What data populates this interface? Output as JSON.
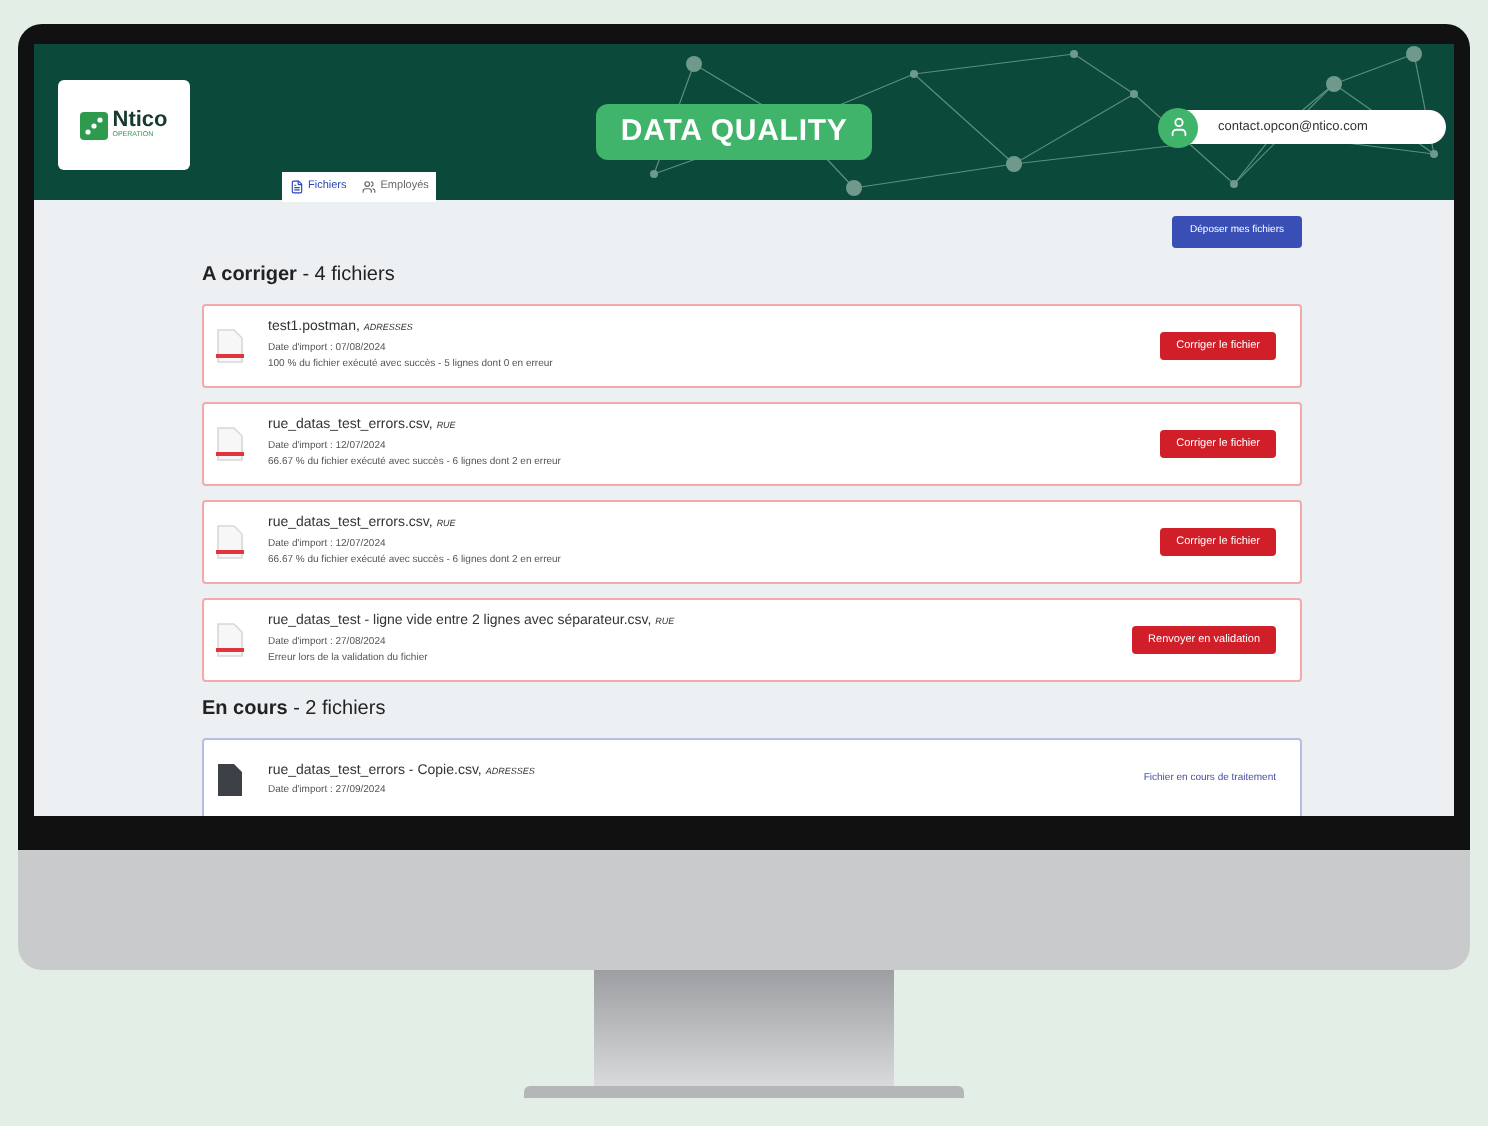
{
  "header": {
    "logo": {
      "name": "Ntico",
      "tagline": "OPERATION"
    },
    "title": "DATA QUALITY",
    "user_email": "contact.opcon@ntico.com"
  },
  "tabs": [
    {
      "label": "Fichiers",
      "selected": true,
      "kind": "file"
    },
    {
      "label": "Employés",
      "selected": false,
      "kind": "user"
    }
  ],
  "upload_button": "Déposer mes fichiers",
  "sections": [
    {
      "title": "**A corriger** - 4 fichiers",
      "kind": "error",
      "files": [
        {
          "name": "test1.postman,",
          "source": "ADRESSES",
          "date": "Date d'import : 07/08/2024",
          "detail": "100 % du fichier exécuté avec succès - 5 lignes dont 0 en erreur",
          "action": "Corriger le fichier"
        },
        {
          "name": "rue_datas_test_errors.csv,",
          "source": "RUE",
          "date": "Date d'import : 12/07/2024",
          "detail": "66.67 % du fichier exécuté avec succès - 6 lignes dont 2 en erreur",
          "action": "Corriger le fichier"
        },
        {
          "name": "rue_datas_test_errors.csv,",
          "source": "RUE",
          "date": "Date d'import : 12/07/2024",
          "detail": "66.67 % du fichier exécuté avec succès - 6 lignes dont 2 en erreur",
          "action": "Corriger le fichier"
        },
        {
          "name": "rue_datas_test - ligne vide entre 2 lignes avec séparateur.csv,",
          "source": "RUE",
          "date": "Date d'import : 27/08/2024",
          "detail": "Erreur lors de la validation du fichier",
          "action": "Renvoyer en validation"
        }
      ]
    },
    {
      "title": "**En cours** - 2 fichiers",
      "kind": "progress",
      "files": [
        {
          "name": "rue_datas_test_errors - Copie.csv,",
          "source": "ADRESSES",
          "date": "Date d'import : 27/09/2024",
          "status": "Fichier en cours de traitement"
        }
      ]
    }
  ]
}
